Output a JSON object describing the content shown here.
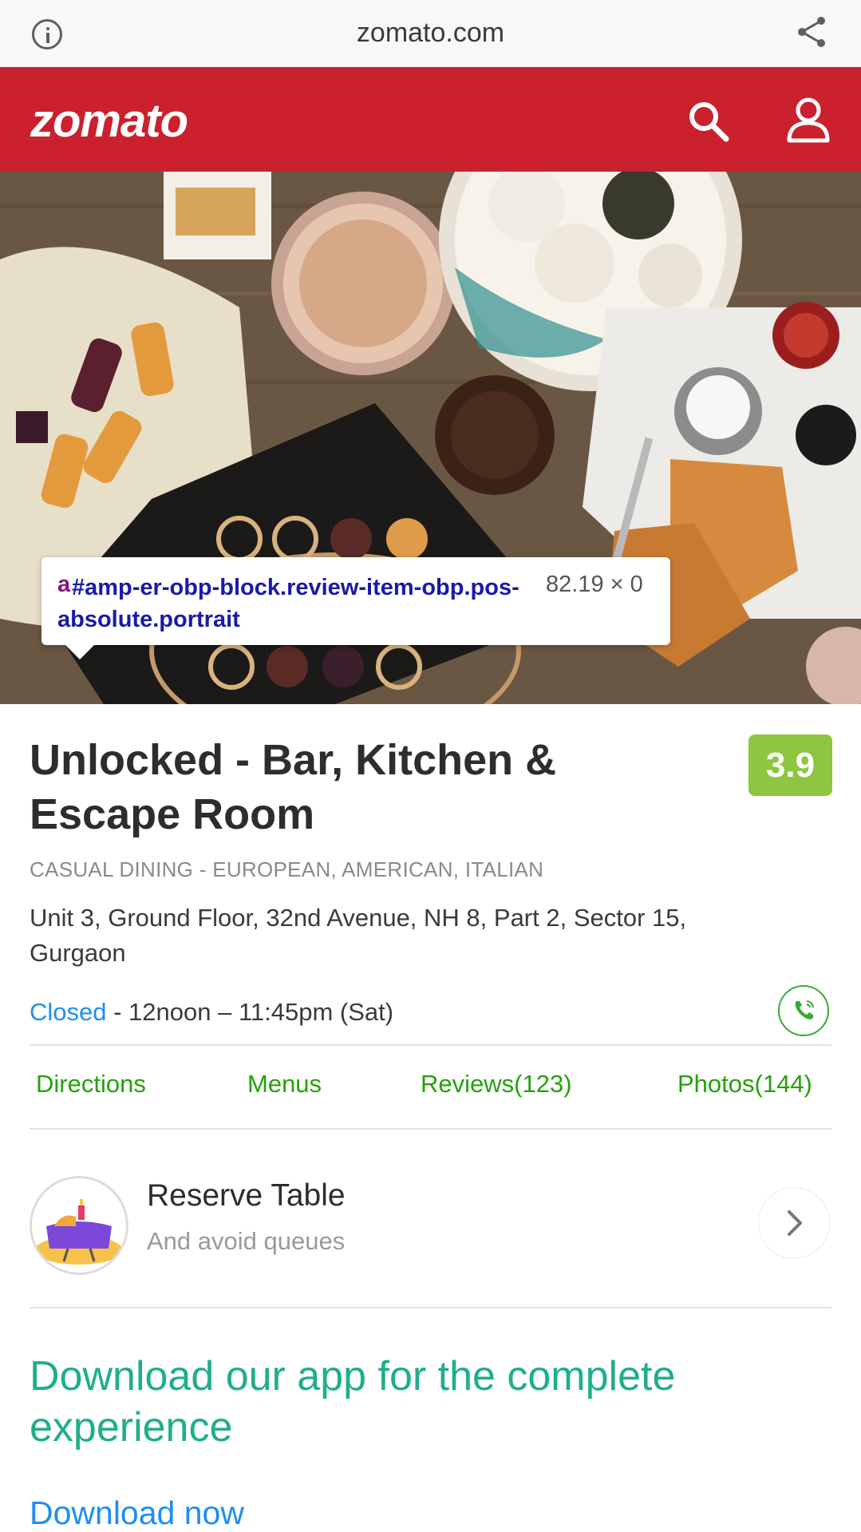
{
  "browser": {
    "url": "zomato.com",
    "icons": {
      "info": "info-icon",
      "share": "share-icon"
    }
  },
  "header": {
    "logo": "zomato",
    "icons": {
      "search": "search-icon",
      "account": "user-icon"
    },
    "brand_color": "#cb202d"
  },
  "hero": {
    "tooltip": {
      "tag": "a",
      "selector": "#amp-er-obp-block.review-item-obp.pos-absolute.portrait",
      "dimensions": "82.19 × 0"
    }
  },
  "restaurant": {
    "name": "Unlocked - Bar, Kitchen & Escape Room",
    "rating": "3.9",
    "rating_color": "#8dc63f",
    "cuisine": "CASUAL DINING - EUROPEAN, AMERICAN, ITALIAN",
    "address": "Unit 3, Ground Floor, 32nd Avenue, NH 8, Part 2, Sector 15, Gurgaon",
    "status": "Closed",
    "hours": " - 12noon – 11:45pm (Sat)",
    "call_icon": "phone-icon"
  },
  "tabs": [
    {
      "label": "Directions"
    },
    {
      "label": "Menus"
    },
    {
      "label": "Reviews(123)"
    },
    {
      "label": "Photos(144)"
    }
  ],
  "reserve": {
    "title": "Reserve Table",
    "subtitle": "And avoid queues",
    "icon": "reserve-table-icon",
    "chevron": "chevron-right-icon"
  },
  "download": {
    "heading": "Download our app for the complete experience",
    "link": "Download now"
  }
}
